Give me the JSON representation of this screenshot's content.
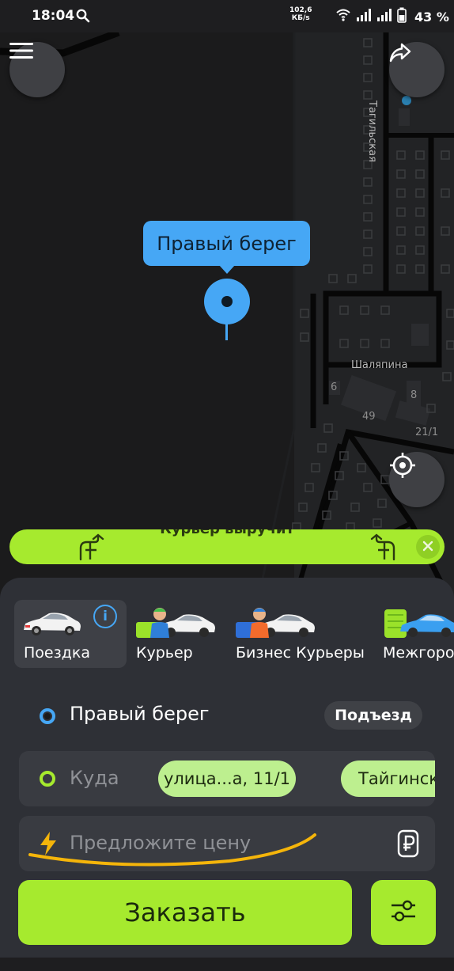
{
  "status_bar": {
    "time": "18:04",
    "net_speed_value": "102,6",
    "net_speed_unit": "КБ/s",
    "battery": "43 %",
    "icons": [
      "search-icon",
      "wifi-icon",
      "signal-icon",
      "signal-icon",
      "battery-icon"
    ]
  },
  "map": {
    "pickup_label": "Правый берег",
    "streets": {
      "tagilskaya": "Тагильская",
      "shalyapina": "Шаляпина"
    },
    "house_numbers": [
      "6",
      "8",
      "49",
      "21/1"
    ],
    "buttons": {
      "menu": "menu-icon",
      "share": "share-icon",
      "locate": "crosshair-icon"
    }
  },
  "banner": {
    "text": "Курьер выручит",
    "icons": [
      "sheet-stand-icon",
      "sheet-stand-icon",
      "close-icon"
    ]
  },
  "categories": [
    {
      "label": "Поездка",
      "active": true,
      "has_info": true
    },
    {
      "label": "Курьер",
      "active": false
    },
    {
      "label": "Бизнес Курьеры",
      "active": false
    },
    {
      "label": "Межгород",
      "active": false
    }
  ],
  "info_glyph": "i",
  "from": {
    "address": "Правый берег",
    "entrance_label": "Подъезд"
  },
  "to": {
    "placeholder": "Куда",
    "suggestions": [
      "улица...а, 11/1",
      "Тайгинская"
    ]
  },
  "price": {
    "placeholder": "Предложите цену",
    "icon": "ruble-icon"
  },
  "order_button": "Заказать",
  "colors": {
    "accent_green": "#a6ea2e",
    "accent_blue": "#46a7f5",
    "sheet_bg": "#2e3036",
    "map_bg": "#1b1b1c",
    "annotation": "#f5b50a"
  }
}
